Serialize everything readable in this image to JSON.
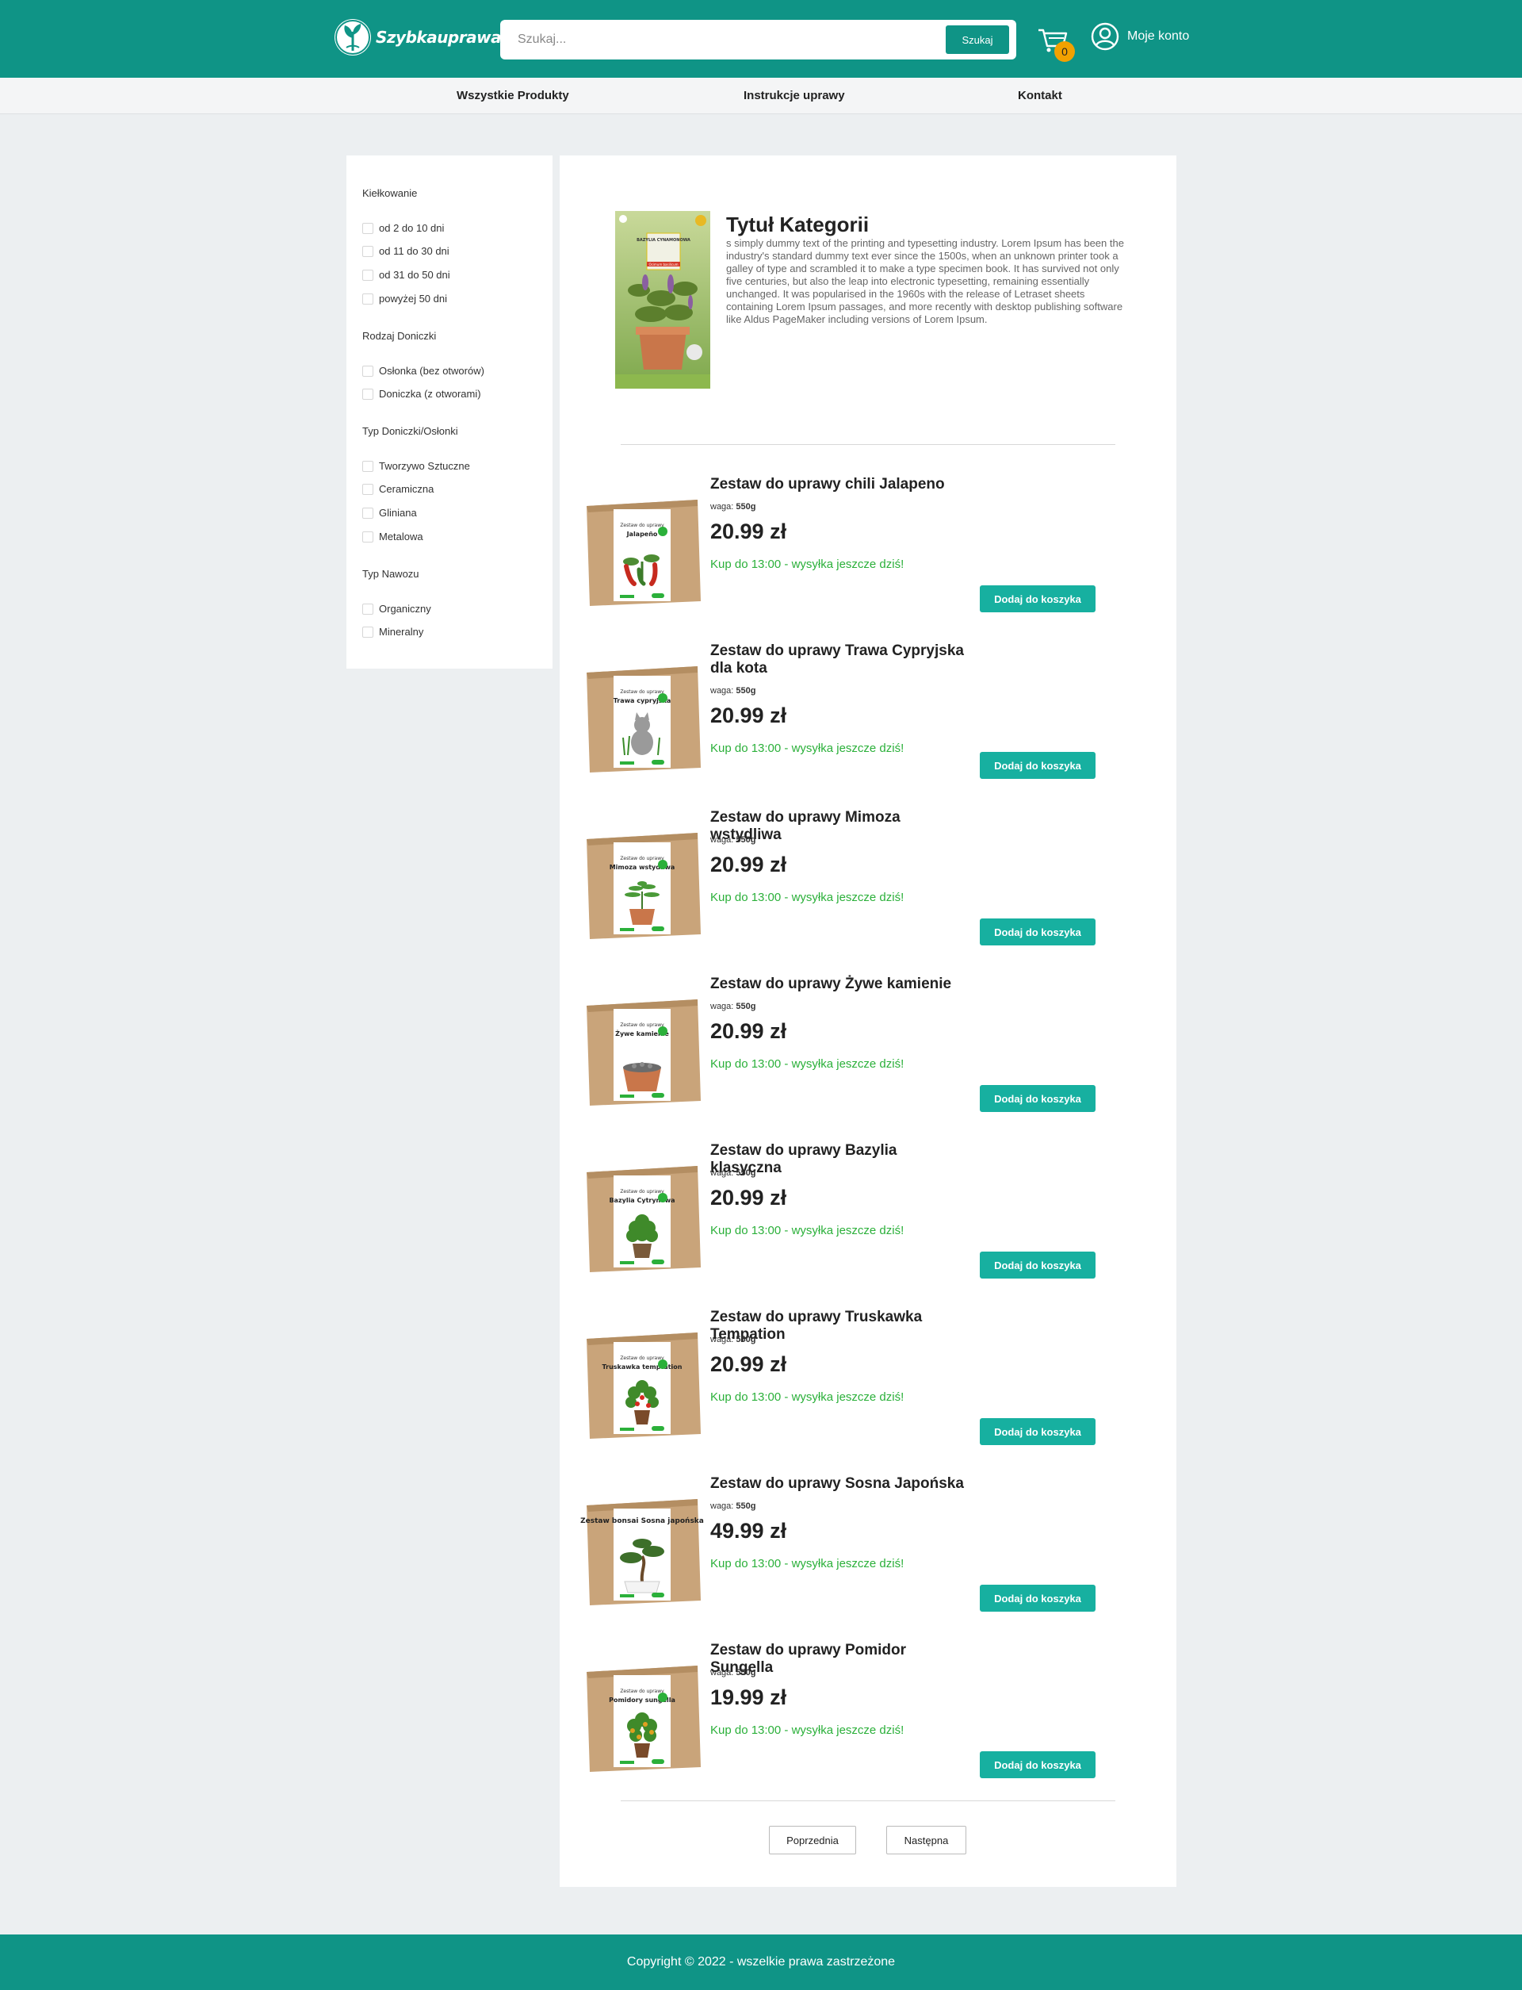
{
  "header": {
    "logo_text": "Szybkauprawa",
    "search_placeholder": "Szukaj...",
    "search_button": "Szukaj",
    "cart_count": "0",
    "account_label": "Moje konto",
    "brand_color": "#0f9486"
  },
  "nav": {
    "items": [
      "Wszystkie Produkty",
      "Instrukcje uprawy",
      "Kontakt"
    ]
  },
  "filters": {
    "germination_title": "Kiełkowanie",
    "germination_options": [
      "od 2 do 10 dni",
      "od 11 do 30 dni",
      "od 31 do 50 dni",
      "powyżej 50 dni"
    ],
    "pot_kind_title": "Rodzaj Doniczki",
    "pot_kind_options": [
      "Osłonka (bez otworów)",
      "Doniczka (z otworami)"
    ],
    "pot_type_title": "Typ Doniczki/Osłonki",
    "pot_type_options": [
      "Tworzywo Sztuczne",
      "Ceramiczna",
      "Gliniana",
      "Metalowa"
    ],
    "fertilizer_title": "Typ Nawozu",
    "fertilizer_options": [
      "Organiczny",
      "Mineralny"
    ]
  },
  "category": {
    "title": "Tytuł Kategorii",
    "description": "s simply dummy text of the printing and typesetting industry. Lorem Ipsum has been the industry's standard dummy text ever since the 1500s, when an unknown printer took a galley of type and scrambled it to make a type specimen book. It has survived not only five centuries, but also the leap into electronic typesetting, remaining essentially unchanged. It was popularised in the 1960s with the release of Letraset sheets containing Lorem Ipsum passages, and more recently with desktop publishing software like Aldus PageMaker including versions of Lorem Ipsum.",
    "image_label_top": "BAZYLIA CYNAMONOWA",
    "image_label_bottom": "Ocimum basilicum"
  },
  "product_common": {
    "weight_label": "waga:",
    "weight_value": "550g",
    "shipping_note": "Kup do 13:00 - wysyłka jeszcze dziś!",
    "add_to_cart": "Dodaj do koszyka"
  },
  "products": [
    {
      "title": "Zestaw do uprawy chili Jalapeno",
      "price": "20.99 zł",
      "box_title": "Jalapeño",
      "plant": "chili"
    },
    {
      "title": "Zestaw do uprawy Trawa Cypryjska dla kota",
      "price": "20.99 zł",
      "box_title": "Trawa cypryjska",
      "plant": "cat"
    },
    {
      "title": "Zestaw do uprawy Mimoza wstydliwa",
      "price": "20.99 zł",
      "box_title": "Mimoza wstydliwa",
      "plant": "mimosa"
    },
    {
      "title": "Zestaw do uprawy Żywe kamienie",
      "price": "20.99 zł",
      "box_title": "Żywe kamienie",
      "plant": "stones"
    },
    {
      "title": "Zestaw do uprawy Bazylia klasyczna",
      "price": "20.99 zł",
      "box_title": "Bazylia Cytrynowa",
      "plant": "basil"
    },
    {
      "title": "Zestaw do uprawy Truskawka Tempation",
      "price": "20.99 zł",
      "box_title": "Truskawka temptation",
      "plant": "strawberry"
    },
    {
      "title": "Zestaw do uprawy Sosna Japońska",
      "price": "49.99 zł",
      "box_title": "Zestaw bonsai Sosna japońska",
      "plant": "bonsai"
    },
    {
      "title": "Zestaw do uprawy Pomidor Sungella",
      "price": "19.99 zł",
      "box_title": "Pomidory sungella",
      "plant": "tomato"
    }
  ],
  "box_header": "Zestaw do uprawy",
  "pagination": {
    "prev": "Poprzednia",
    "next": "Następna"
  },
  "footer": {
    "copyright": "Copyright © 2022 - wszelkie prawa zastrzeżone"
  }
}
